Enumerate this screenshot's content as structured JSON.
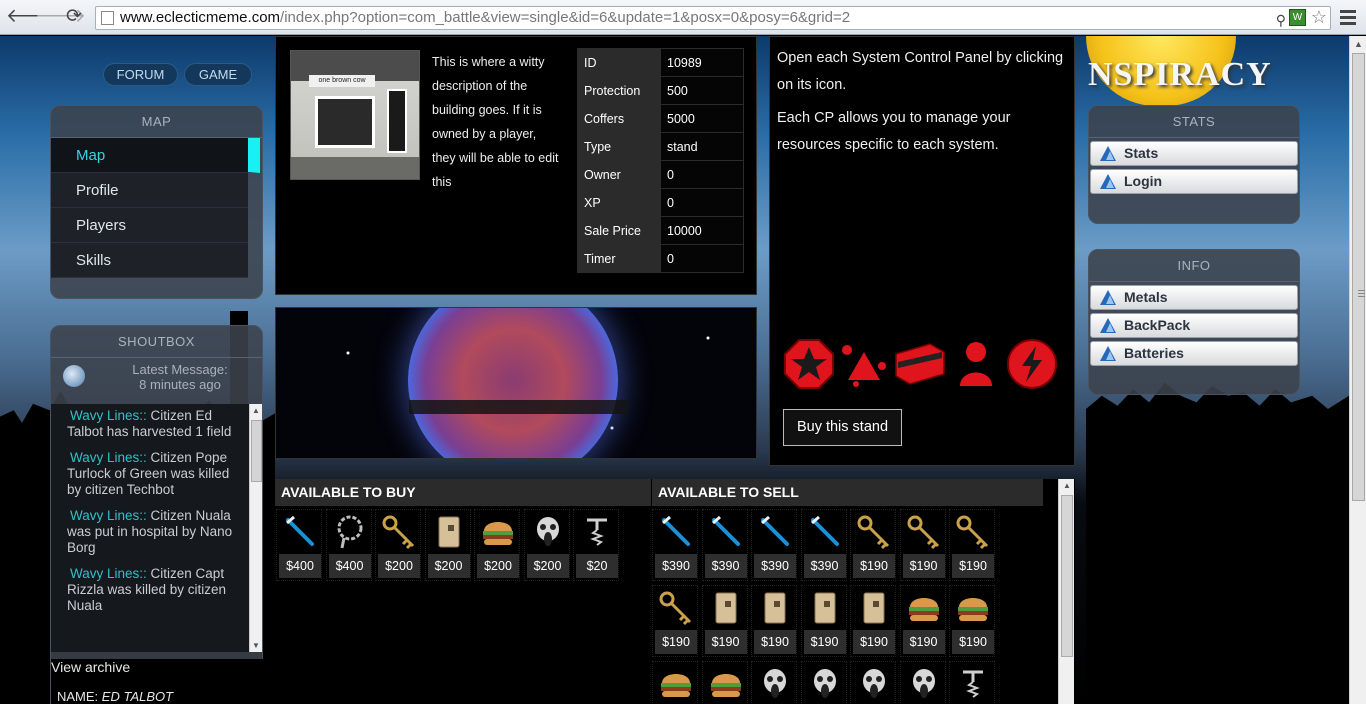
{
  "browser": {
    "url_domain": "www.eclecticmeme.com",
    "url_path": "/index.php?option=com_battle&view=single&id=6&update=1&posx=0&posy=6&grid=2"
  },
  "top_nav": {
    "forum_label": "FORUM",
    "game_label": "GAME"
  },
  "logo_text": "NSPIRACY",
  "map_panel": {
    "title": "MAP",
    "items": [
      {
        "label": "Map",
        "active": true
      },
      {
        "label": "Profile",
        "active": false
      },
      {
        "label": "Players",
        "active": false
      },
      {
        "label": "Skills",
        "active": false
      }
    ]
  },
  "shoutbox": {
    "title": "SHOUTBOX",
    "latest_label": "Latest Message:",
    "latest_time": "8 minutes ago",
    "messages": [
      {
        "who": "Wavy Lines::",
        "text": " Citizen Ed Talbot has harvested 1 field"
      },
      {
        "who": "Wavy Lines::",
        "text": " Citizen Pope Turlock of Green was killed by citizen Techbot"
      },
      {
        "who": "Wavy Lines::",
        "text": " Citizen Nuala was put in hospital by Nano Borg"
      },
      {
        "who": "Wavy Lines::",
        "text": " Citizen Capt Rizzla was killed by citizen Nuala"
      }
    ],
    "view_archive": "View archive",
    "name_label": "NAME:",
    "name_value": "ED TALBOT"
  },
  "building": {
    "sign_text": "one brown cow",
    "description": "This is where a witty description of the building goes. If it is owned by a player, they will be able to edit this",
    "stats": [
      {
        "key": "ID",
        "value": "10989"
      },
      {
        "key": "Protection",
        "value": "500"
      },
      {
        "key": "Coffers",
        "value": "5000"
      },
      {
        "key": "Type",
        "value": "stand"
      },
      {
        "key": "Owner",
        "value": "0"
      },
      {
        "key": "XP",
        "value": "0"
      },
      {
        "key": "Sale Price",
        "value": "10000"
      },
      {
        "key": "Timer",
        "value": "0"
      }
    ]
  },
  "control_panel": {
    "text1": "Open each System Control Panel by clicking on its icon.",
    "text2": "Each CP allows you to manage your resources specific to each system.",
    "icons": [
      "star-octagon-icon",
      "triangle-dots-icon",
      "battery-icon",
      "person-icon",
      "lightning-icon"
    ],
    "buy_label": "Buy this stand"
  },
  "market": {
    "buy_title": "AVAILABLE TO BUY",
    "sell_title": "AVAILABLE TO SELL",
    "buy_items": [
      {
        "icon": "toothbrush-icon",
        "price": "$400"
      },
      {
        "icon": "chain-icon",
        "price": "$400"
      },
      {
        "icon": "key-icon",
        "price": "$200"
      },
      {
        "icon": "card-icon",
        "price": "$200"
      },
      {
        "icon": "burger-icon",
        "price": "$200"
      },
      {
        "icon": "skull-icon",
        "price": "$200"
      },
      {
        "icon": "corkscrew-icon",
        "price": "$20"
      }
    ],
    "sell_items": [
      {
        "icon": "toothbrush-icon",
        "price": "$390"
      },
      {
        "icon": "toothbrush-icon",
        "price": "$390"
      },
      {
        "icon": "toothbrush-icon",
        "price": "$390"
      },
      {
        "icon": "toothbrush-icon",
        "price": "$390"
      },
      {
        "icon": "key-icon",
        "price": "$190"
      },
      {
        "icon": "key-icon",
        "price": "$190"
      },
      {
        "icon": "key-icon",
        "price": "$190"
      },
      {
        "icon": "key-icon",
        "price": "$190"
      },
      {
        "icon": "card-icon",
        "price": "$190"
      },
      {
        "icon": "card-icon",
        "price": "$190"
      },
      {
        "icon": "card-icon",
        "price": "$190"
      },
      {
        "icon": "card-icon",
        "price": "$190"
      },
      {
        "icon": "burger-icon",
        "price": "$190"
      },
      {
        "icon": "burger-icon",
        "price": "$190"
      },
      {
        "icon": "burger-icon",
        "price": ""
      },
      {
        "icon": "burger-icon",
        "price": ""
      },
      {
        "icon": "skull-icon",
        "price": ""
      },
      {
        "icon": "skull-icon",
        "price": ""
      },
      {
        "icon": "skull-icon",
        "price": ""
      },
      {
        "icon": "skull-icon",
        "price": ""
      },
      {
        "icon": "corkscrew-icon",
        "price": ""
      }
    ]
  },
  "stats_panel": {
    "title": "STATS",
    "buttons": [
      "Stats",
      "Login"
    ]
  },
  "info_panel": {
    "title": "INFO",
    "buttons": [
      "Metals",
      "BackPack",
      "Batteries"
    ]
  },
  "colors": {
    "accent": "#18f0f6",
    "link": "#2ec2c8",
    "cp_red": "#e0141c"
  }
}
